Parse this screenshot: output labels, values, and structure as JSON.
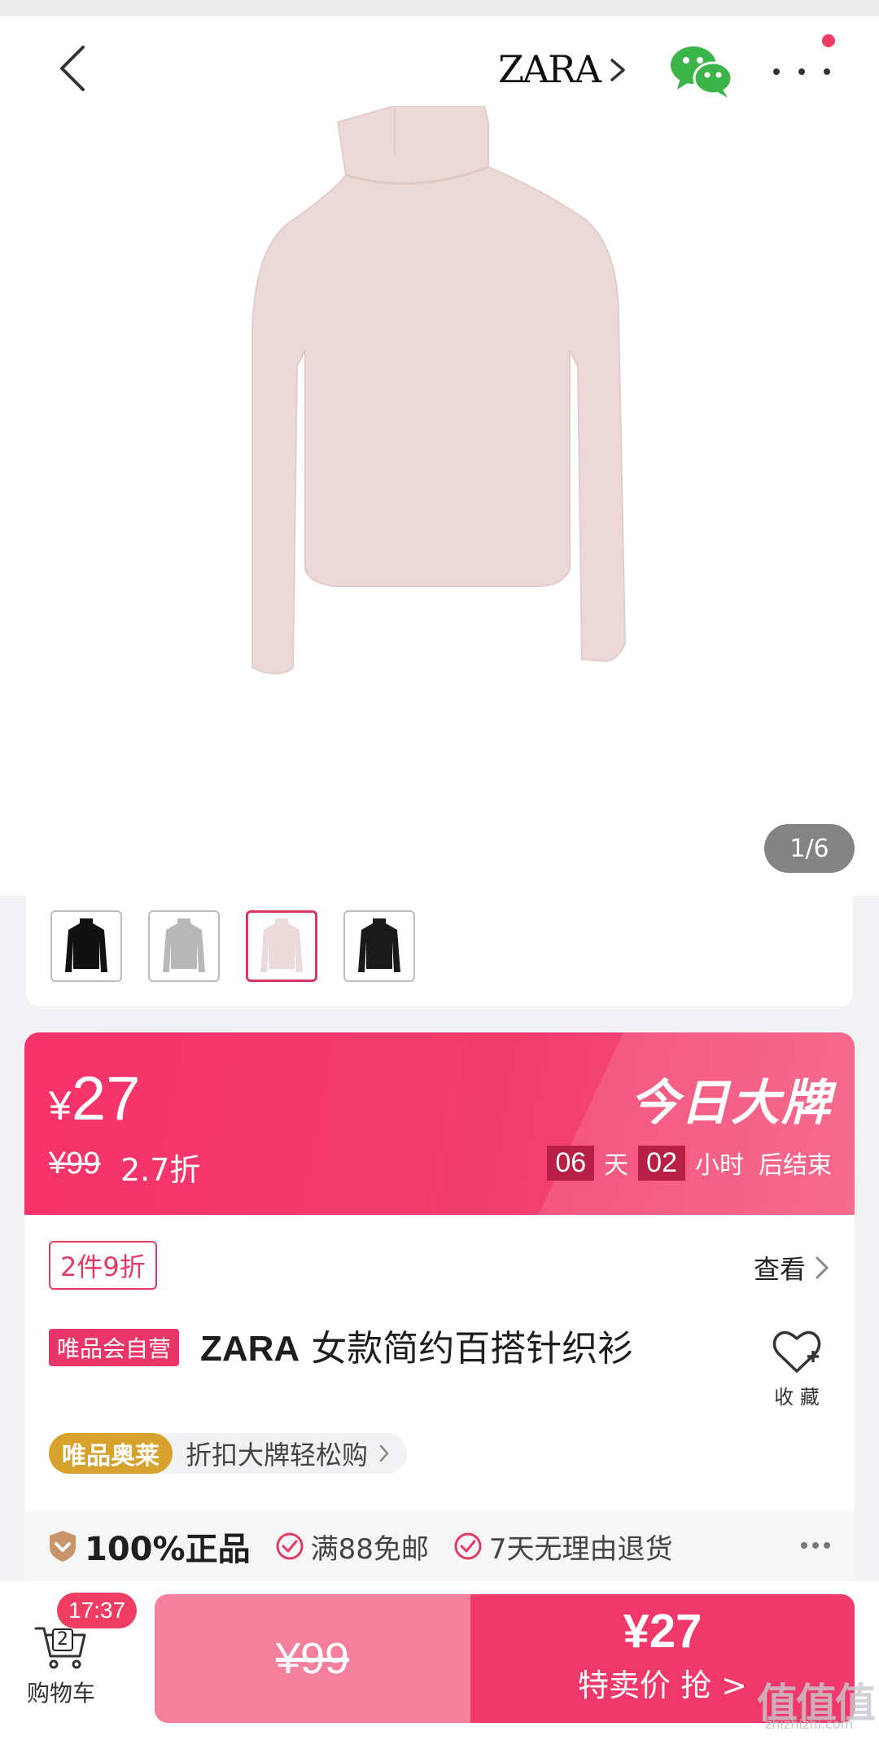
{
  "nav": {
    "brand": "ZARA",
    "back_icon": "chevron-left-icon",
    "wechat_icon": "wechat-icon",
    "more_icon": "more-icon"
  },
  "gallery": {
    "counter": "1/6",
    "thumb_colors": [
      "#111111",
      "#b8b8b8",
      "#ecd9d9",
      "#1a1a1a"
    ],
    "selected_index": 2
  },
  "price": {
    "currency": "¥",
    "current": "27",
    "original": "¥99",
    "discount": "2.7折",
    "campaign": "今日大牌",
    "days": "06",
    "days_label": "天",
    "hours": "02",
    "hours_label": "小时",
    "ends_label": "后结束"
  },
  "product": {
    "promo": "2件9折",
    "view_label": "查看",
    "self_operated": "唯品会自营",
    "brand": "ZARA",
    "name": "女款简约百搭针织衫",
    "favorite_label": "收 藏",
    "outlet_badge": "唯品奥莱",
    "outlet_text": "折扣大牌轻松购"
  },
  "guarantees": {
    "authentic": "100%正品",
    "free_shipping": "满88免邮",
    "returns": "7天无理由退货"
  },
  "bottom": {
    "time": "17:37",
    "cart_count": "2",
    "cart_label": "购物车",
    "original_price": "¥99",
    "buy_price": "¥27",
    "buy_label": "特卖价 抢 >"
  },
  "watermark": {
    "main": "值值值",
    "sub": "zhizhizhi.com"
  },
  "colors": {
    "accent": "#f0386b",
    "outlet_gold": "#d7a12d",
    "sweater": "#ecd9d7"
  }
}
